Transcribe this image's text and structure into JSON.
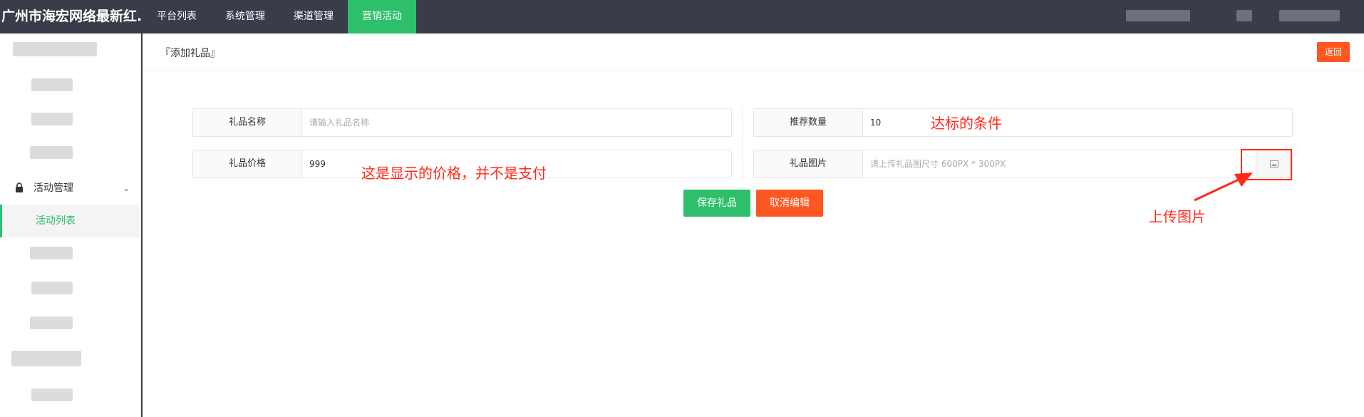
{
  "app": {
    "title": "广州市海宏网络最新红..."
  },
  "topnav": {
    "items": [
      {
        "label": "平台列表"
      },
      {
        "label": "系统管理"
      },
      {
        "label": "渠道管理"
      },
      {
        "label": "营销活动"
      }
    ],
    "active_index": 3
  },
  "sidebar": {
    "group": {
      "label": "活动管理",
      "icon": "lock-icon",
      "chevron": "chevron-down-icon"
    },
    "active_item": {
      "label": "活动列表"
    }
  },
  "page": {
    "title": "『添加礼品』",
    "back_label": "返回"
  },
  "form": {
    "name": {
      "label": "礼品名称",
      "value": "",
      "placeholder": "请输入礼品名称"
    },
    "recommend": {
      "label": "推荐数量",
      "value": "10"
    },
    "price": {
      "label": "礼品价格",
      "value": "999"
    },
    "image": {
      "label": "礼品图片",
      "value": "",
      "placeholder": "请上传礼品图尺寸 600PX * 300PX",
      "icon": "image-icon"
    },
    "save_label": "保存礼品",
    "cancel_label": "取消编辑"
  },
  "annotations": {
    "recommend_note": "达标的条件",
    "price_note": "这是显示的价格，并不是支付",
    "upload_note": "上传图片"
  },
  "colors": {
    "accent": "#2ebf6a",
    "danger": "#ff5722",
    "topbar": "#393d49",
    "annotation": "#ff2a1a"
  }
}
